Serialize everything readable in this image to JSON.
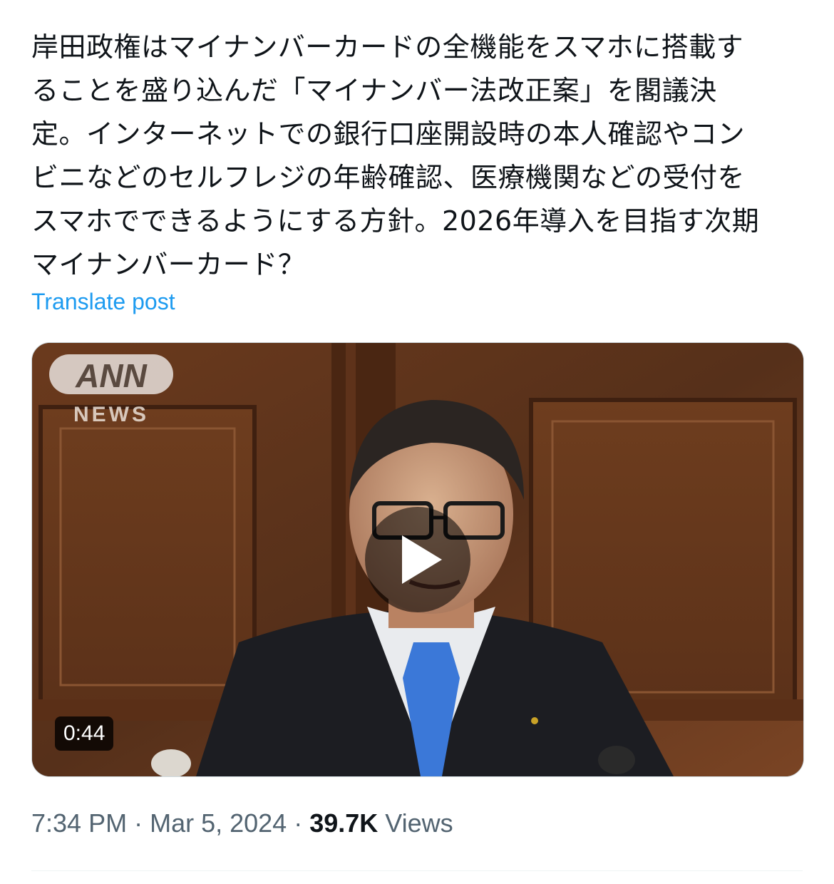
{
  "post": {
    "text_lines": [
      "岸田政権はマイナンバーカードの全機能をスマホに搭載す",
      "ることを盛り込んだ「マイナンバー法改正案」を閣議決",
      "定。インターネットでの銀行口座開設時の本人確認やコン",
      "ビニなどのセルフレジの年齢確認、医療機関などの受付を",
      "スマホでできるようにする方針。2026年導入を目指す次期",
      "マイナンバーカード？"
    ],
    "translate_label": "Translate post"
  },
  "video": {
    "logo_top": "ANN",
    "logo_bottom": "NEWS",
    "duration": "0:44",
    "play_icon": "play-icon"
  },
  "meta": {
    "time": "7:34 PM",
    "separator": "·",
    "date": "Mar 5, 2024",
    "views_count": "39.7K",
    "views_label": "Views"
  },
  "colors": {
    "link": "#1d9bf0",
    "text": "#0f1419",
    "secondary": "#536471"
  }
}
